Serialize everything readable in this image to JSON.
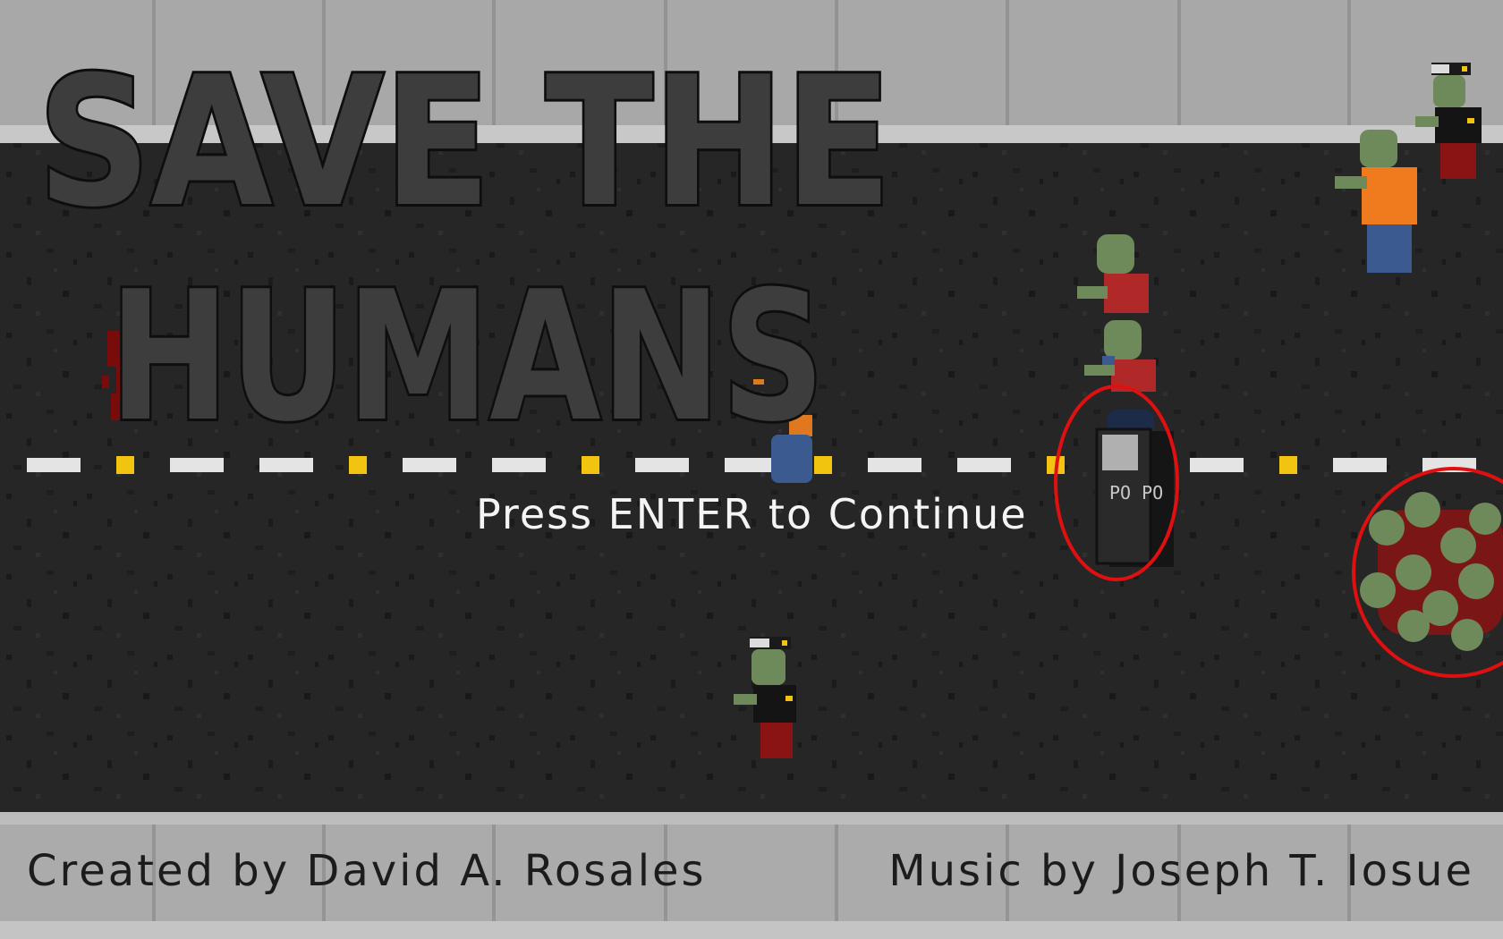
{
  "game": {
    "title_line1": "SAVE THE",
    "title_line2": "HUMANS",
    "prompt": "Press ENTER to Continue",
    "credits": {
      "created_by": "Created by David A. Rosales",
      "music_by": "Music by Joseph T. Iosue"
    }
  },
  "sprites": {
    "zombie_police_top_right": "zombie-police-cap-icon",
    "zombie_orange_shirt": "zombie-orange-shirt-icon",
    "zombie_red_shirt_upper": "zombie-red-shirt-icon",
    "zombie_red_shirt_lower": "zombie-red-shirt-icon",
    "riot_shield_unit": "riot-police-shield-icon",
    "shield_text": "PO PO",
    "zombie_horde": "zombie-horde-icon",
    "zombie_police_bottom": "zombie-police-cap-icon",
    "fallen_human": "human-blue-pants-icon"
  },
  "colors": {
    "road": "#262626",
    "sidewalk": "#ababab",
    "lane_white": "#e4e4e4",
    "lane_yellow": "#f1c40f",
    "title_fill": "#3d3d3d",
    "title_outline": "#0e0e0e",
    "highlight_circle": "#e01010",
    "zombie_skin": "#6f8a5a"
  }
}
